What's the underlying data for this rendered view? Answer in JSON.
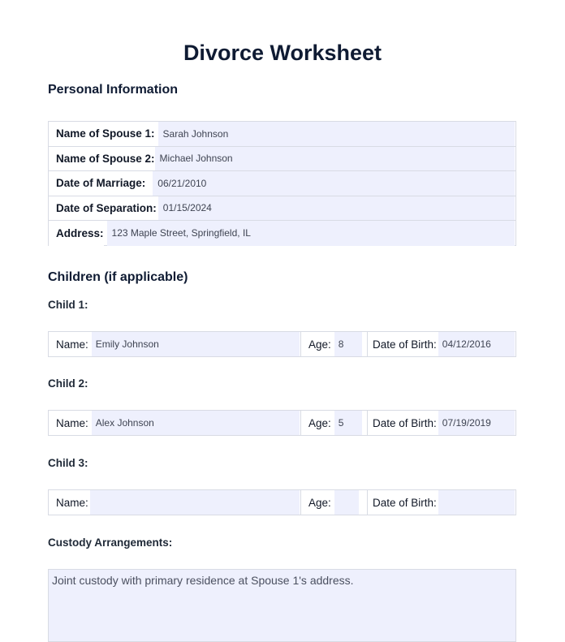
{
  "document": {
    "title": "Divorce Worksheet"
  },
  "personal": {
    "heading": "Personal Information",
    "fields": [
      {
        "label": "Name of Spouse 1:",
        "value": "Sarah Johnson"
      },
      {
        "label": "Name of Spouse 2:",
        "value": "Michael Johnson"
      },
      {
        "label": "Date of Marriage:",
        "value": "06/21/2010"
      },
      {
        "label": "Date of Separation:",
        "value": "01/15/2024"
      },
      {
        "label": "Address:",
        "value": "123 Maple Street, Springfield, IL"
      }
    ]
  },
  "children": {
    "heading": "Children (if applicable)",
    "name_label": "Name:",
    "age_label": "Age:",
    "dob_label": "Date of Birth:",
    "items": [
      {
        "heading": "Child 1:",
        "name": "Emily Johnson",
        "age": "8",
        "dob": "04/12/2016"
      },
      {
        "heading": "Child 2:",
        "name": "Alex Johnson",
        "age": "5",
        "dob": "07/19/2019"
      },
      {
        "heading": "Child 3:",
        "name": "",
        "age": "",
        "dob": ""
      }
    ]
  },
  "custody": {
    "heading": "Custody Arrangements:",
    "value": "Joint custody with primary residence at Spouse 1's address."
  }
}
